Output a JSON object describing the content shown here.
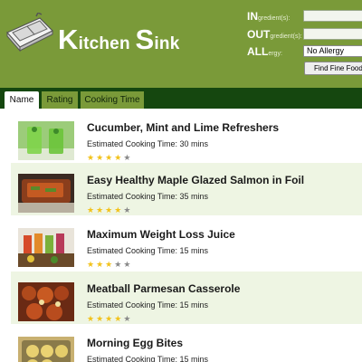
{
  "header": {
    "logo_first_k": "K",
    "logo_first_rest": "itchen",
    "logo_second_s": "S",
    "logo_second_rest": "ink",
    "ingredient_label_main": "IN",
    "ingredient_label_sub": "gredient(s):",
    "ingredient_value": "",
    "outgredient_label_main": "OUT",
    "outgredient_label_sub": "gredient(s):",
    "outgredient_value": "",
    "allergy_label_main": "ALL",
    "allergy_label_sub": "ergy:",
    "allergy_selected": "No Allergy",
    "find_button": "Find Fine Food"
  },
  "tabs": [
    {
      "label": "Name",
      "active": true
    },
    {
      "label": "Rating",
      "active": false
    },
    {
      "label": "Cooking Time",
      "active": false
    }
  ],
  "recipes": [
    {
      "title": "Cucumber, Mint and Lime Refreshers",
      "time": "Estimated Cooking Time: 30 mins",
      "rating": 4
    },
    {
      "title": "Easy Healthy Maple Glazed Salmon in Foil",
      "time": "Estimated Cooking Time: 35 mins",
      "rating": 4
    },
    {
      "title": "Maximum Weight Loss Juice",
      "time": "Estimated Cooking Time: 15 mins",
      "rating": 3
    },
    {
      "title": "Meatball Parmesan Casserole",
      "time": "Estimated Cooking Time: 15 mins",
      "rating": 4
    },
    {
      "title": "Morning Egg Bites",
      "time": "Estimated Cooking Time: 15 mins",
      "rating": 4
    }
  ],
  "colors": {
    "header_bg": "#7a9a39",
    "tab_bar_bg": "#15470f",
    "row_shade": "#eef5e3",
    "star_on": "#f2c21b",
    "star_off": "#8a8a8a"
  }
}
